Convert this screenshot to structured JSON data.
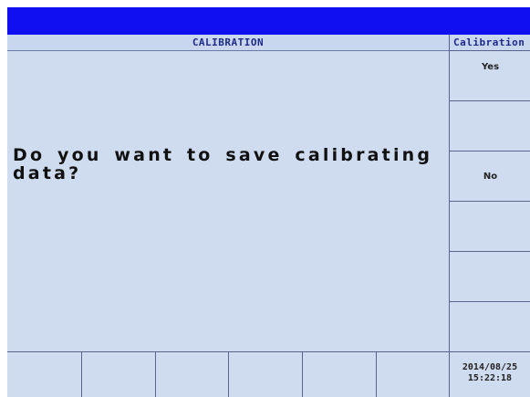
{
  "header": {
    "title": "CALIBRATION"
  },
  "dialog": {
    "question": "Do you want to save calibrating data?"
  },
  "side_panel": {
    "title": "Calibration",
    "keys": [
      {
        "label": "Yes"
      },
      {
        "label": ""
      },
      {
        "label": "No"
      },
      {
        "label": ""
      },
      {
        "label": ""
      },
      {
        "label": ""
      }
    ]
  },
  "bottom_bar": {
    "function_keys": [
      "",
      "",
      "",
      "",
      "",
      ""
    ],
    "date": "2014/08/25",
    "time": "15:22:18"
  },
  "colors": {
    "title_bar": "#0f0ff0",
    "background": "#cfdcef",
    "header_text": "#1e2a8a",
    "border": "#58648e"
  }
}
